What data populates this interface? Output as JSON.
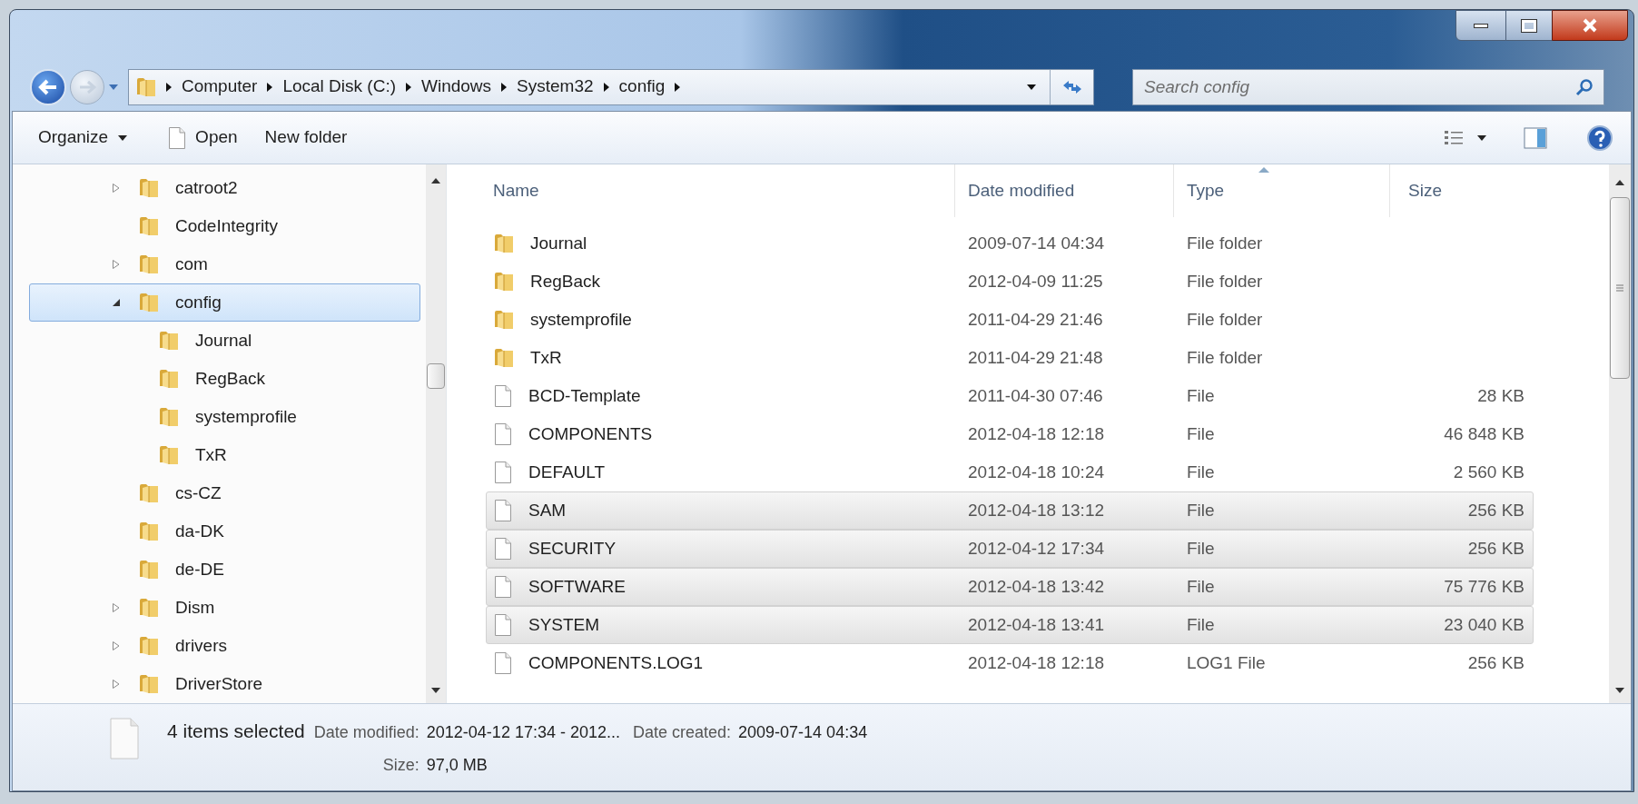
{
  "address_bar": {
    "breadcrumbs": [
      "Computer",
      "Local Disk (C:)",
      "Windows",
      "System32",
      "config"
    ]
  },
  "search": {
    "placeholder": "Search config"
  },
  "toolbar": {
    "items": [
      {
        "label": "Organize",
        "kind": "menu"
      },
      {
        "label": "Open",
        "kind": "file"
      },
      {
        "label": "New folder",
        "kind": "plain"
      }
    ]
  },
  "tree": {
    "items": [
      {
        "label": "catroot2",
        "expanded": false,
        "selected": false
      },
      {
        "label": "CodeIntegrity",
        "selected": false
      },
      {
        "label": "com",
        "expanded": false,
        "selected": false
      },
      {
        "label": "config",
        "expanded": true,
        "selected": true,
        "children": [
          {
            "label": "Journal",
            "selected": false
          },
          {
            "label": "RegBack",
            "selected": false
          },
          {
            "label": "systemprofile",
            "selected": false
          },
          {
            "label": "TxR",
            "selected": false
          }
        ]
      },
      {
        "label": "cs-CZ",
        "selected": false
      },
      {
        "label": "da-DK",
        "selected": false
      },
      {
        "label": "de-DE",
        "selected": false
      },
      {
        "label": "Dism",
        "expanded": false,
        "selected": false
      },
      {
        "label": "drivers",
        "expanded": false,
        "selected": false
      },
      {
        "label": "DriverStore",
        "expanded": false,
        "selected": false
      }
    ]
  },
  "table": {
    "columns": [
      {
        "label": "Name",
        "sorted": false
      },
      {
        "label": "Date modified",
        "sorted": false
      },
      {
        "label": "Type",
        "sorted": true
      },
      {
        "label": "Size",
        "sorted": false
      }
    ],
    "rows": [
      {
        "name": "Journal",
        "date": "2009-07-14 04:34",
        "type": "File folder",
        "kind": "folder",
        "selected": false
      },
      {
        "name": "RegBack",
        "date": "2012-04-09 11:25",
        "type": "File folder",
        "kind": "folder",
        "selected": false
      },
      {
        "name": "systemprofile",
        "date": "2011-04-29 21:46",
        "type": "File folder",
        "kind": "folder",
        "selected": false
      },
      {
        "name": "TxR",
        "date": "2011-04-29 21:48",
        "type": "File folder",
        "kind": "folder",
        "selected": false
      },
      {
        "name": "BCD-Template",
        "date": "2011-04-30 07:46",
        "type": "File",
        "size": "28 KB",
        "kind": "file",
        "selected": false
      },
      {
        "name": "COMPONENTS",
        "date": "2012-04-18 12:18",
        "type": "File",
        "size": "46 848 KB",
        "kind": "file",
        "selected": false
      },
      {
        "name": "DEFAULT",
        "date": "2012-04-18 10:24",
        "type": "File",
        "size": "2 560 KB",
        "kind": "file",
        "selected": false
      },
      {
        "name": "SAM",
        "date": "2012-04-18 13:12",
        "type": "File",
        "size": "256 KB",
        "kind": "file",
        "selected": true
      },
      {
        "name": "SECURITY",
        "date": "2012-04-12 17:34",
        "type": "File",
        "size": "256 KB",
        "kind": "file",
        "selected": true
      },
      {
        "name": "SOFTWARE",
        "date": "2012-04-18 13:42",
        "type": "File",
        "size": "75 776 KB",
        "kind": "file",
        "selected": true
      },
      {
        "name": "SYSTEM",
        "date": "2012-04-18 13:41",
        "type": "File",
        "size": "23 040 KB",
        "kind": "file",
        "selected": true
      },
      {
        "name": "COMPONENTS.LOG1",
        "date": "2012-04-18 12:18",
        "type": "LOG1 File",
        "size": "256 KB",
        "kind": "file",
        "selected": false
      }
    ]
  },
  "status_bar": {
    "summary": "4 items selected",
    "details": [
      {
        "label": "Date modified:",
        "value": "2012-04-12 17:34 - 2012..."
      },
      {
        "label": "Date created:",
        "value": "2009-07-14 04:34"
      },
      {
        "label": "Size:",
        "value": "97,0 MB"
      }
    ]
  }
}
